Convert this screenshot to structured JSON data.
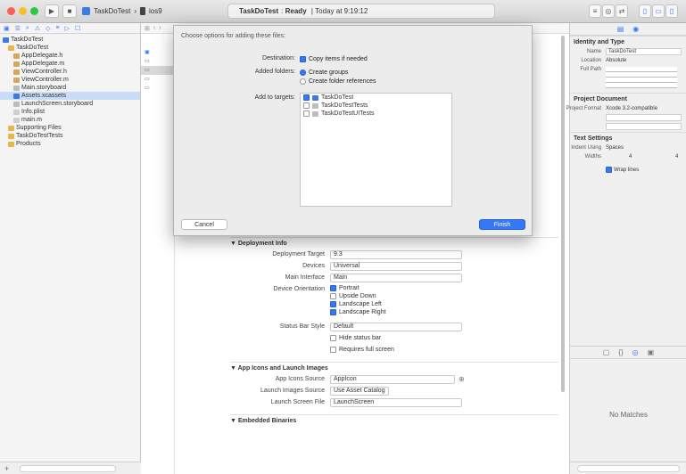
{
  "toolbar": {
    "scheme": "TaskDoTest",
    "device": "ios9",
    "activity_project": "TaskDoTest",
    "activity_status": "Ready",
    "activity_time": "Today at 9:19:12"
  },
  "navigator": {
    "items": [
      {
        "label": "TaskDoTest",
        "indent": 0,
        "icon": "#3f7ae0"
      },
      {
        "label": "TaskDoTest",
        "indent": 1,
        "icon": "#e6b84b"
      },
      {
        "label": "AppDelegate.h",
        "indent": 2,
        "icon": "#d6a75f"
      },
      {
        "label": "AppDelegate.m",
        "indent": 2,
        "icon": "#d6a75f"
      },
      {
        "label": "ViewController.h",
        "indent": 2,
        "icon": "#d6a75f"
      },
      {
        "label": "ViewController.m",
        "indent": 2,
        "icon": "#d6a75f"
      },
      {
        "label": "Main.storyboard",
        "indent": 2,
        "icon": "#bcbcbc"
      },
      {
        "label": "Assets.xcassets",
        "indent": 2,
        "icon": "#3f7ae0",
        "selected": true
      },
      {
        "label": "LaunchScreen.storyboard",
        "indent": 2,
        "icon": "#bcbcbc"
      },
      {
        "label": "Info.plist",
        "indent": 2,
        "icon": "#cfcfcf"
      },
      {
        "label": "main.m",
        "indent": 2,
        "icon": "#cfcfcf"
      },
      {
        "label": "Supporting Files",
        "indent": 1,
        "icon": "#e6b84b"
      },
      {
        "label": "TaskDoTestTests",
        "indent": 1,
        "icon": "#e6b84b"
      },
      {
        "label": "Products",
        "indent": 1,
        "icon": "#e6b84b"
      }
    ]
  },
  "dialog": {
    "title": "Choose options for adding these files:",
    "destination_label": "Destination:",
    "destination_option": "Copy items if needed",
    "added_folders_label": "Added folders:",
    "folders_opt1": "Create groups",
    "folders_opt2": "Create folder references",
    "targets_label": "Add to targets:",
    "targets": [
      {
        "label": "TaskDoTest",
        "checked": true
      },
      {
        "label": "TaskDoTestTests",
        "checked": false
      },
      {
        "label": "TaskDoTestUITests",
        "checked": false
      }
    ],
    "cancel_label": "Cancel",
    "finish_label": "Finish"
  },
  "editor": {
    "deployment_section": "Deployment Info",
    "deployment_target_label": "Deployment Target",
    "deployment_target_value": "9.3",
    "devices_label": "Devices",
    "devices_value": "Universal",
    "main_interface_label": "Main Interface",
    "main_interface_value": "Main",
    "orientation_label": "Device Orientation",
    "orientations": [
      {
        "label": "Portrait",
        "checked": true
      },
      {
        "label": "Upside Down",
        "checked": false
      },
      {
        "label": "Landscape Left",
        "checked": true
      },
      {
        "label": "Landscape Right",
        "checked": true
      }
    ],
    "status_bar_label": "Status Bar Style",
    "status_bar_value": "Default",
    "hide_status_bar": "Hide status bar",
    "requires_full_screen": "Requires full screen",
    "app_icons_section": "App Icons and Launch Images",
    "app_icons_label": "App Icons Source",
    "app_icons_value": "AppIcon",
    "launch_images_label": "Launch Images Source",
    "launch_images_value": "Use Asset Catalog",
    "launch_screen_label": "Launch Screen File",
    "launch_screen_value": "LaunchScreen",
    "embedded_section": "Embedded Binaries"
  },
  "inspector": {
    "identity_header": "Identity and Type",
    "name_label": "Name",
    "name_value": "TaskDoTest",
    "location_label": "Location",
    "location_value": "Absolute",
    "fullpath_label": "Full Path",
    "project_doc_header": "Project Document",
    "project_format_label": "Project Format",
    "project_format_value": "Xcode 3.2-compatible",
    "text_settings_header": "Text Settings",
    "indent_label": "Indent Using",
    "indent_value": "Spaces",
    "widths_label": "Widths",
    "tab_value": "4",
    "indent_num_value": "4",
    "wrap_lines": "Wrap lines",
    "no_matches": "No Matches"
  }
}
